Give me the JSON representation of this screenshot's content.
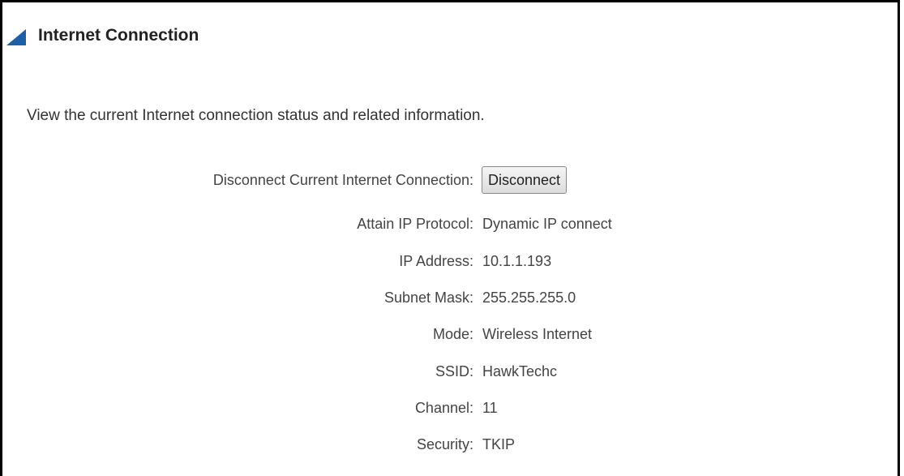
{
  "header": {
    "title": "Internet Connection"
  },
  "description": "View the current Internet connection status and related information.",
  "disconnect": {
    "label": "Disconnect Current Internet Connection:",
    "button_label": "Disconnect"
  },
  "status_rows": [
    {
      "label": "Attain IP Protocol:",
      "value": "Dynamic IP connect"
    },
    {
      "label": "IP Address:",
      "value": "10.1.1.193"
    },
    {
      "label": "Subnet Mask:",
      "value": "255.255.255.0"
    },
    {
      "label": "Mode:",
      "value": "Wireless Internet"
    },
    {
      "label": "SSID:",
      "value": "HawkTechc"
    },
    {
      "label": "Channel:",
      "value": "11"
    },
    {
      "label": "Security:",
      "value": "TKIP"
    }
  ],
  "colors": {
    "header_marker": "#1f5fa8",
    "frame_border": "#000000"
  }
}
